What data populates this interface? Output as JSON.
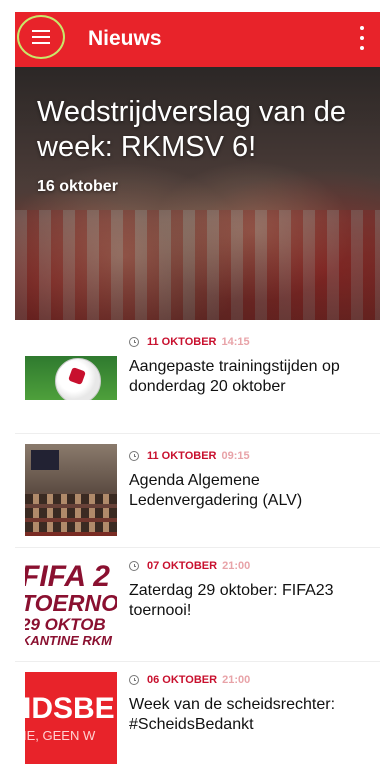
{
  "appbar": {
    "title": "Nieuws",
    "menu_icon": "hamburger-menu-icon",
    "more_icon": "more-vertical-icon",
    "color": "#e8232a"
  },
  "featured": {
    "title": "Wedstrijdverslag van de week: RKMSV 6!",
    "date": "16 oktober"
  },
  "articles": [
    {
      "date": "11 OKTOBER",
      "time": "14:15",
      "title": "Aangepaste trainingstijden op donderdag 20 oktober"
    },
    {
      "date": "11 OKTOBER",
      "time": "09:15",
      "title": "Agenda Algemene Ledenvergadering (ALV)"
    },
    {
      "date": "07 OKTOBER",
      "time": "21:00",
      "title": "Zaterdag 29 oktober: FIFA23 toernooi!"
    },
    {
      "date": "06 OKTOBER",
      "time": "21:00",
      "title": "Week van de scheidsrechter: #ScheidsBedankt"
    }
  ],
  "thumbs": {
    "fifa_lines": [
      "FIFA 2",
      "TOERNO",
      "29 OKTOB",
      "KANTINE RKM"
    ],
    "ref_big": "IDSBE",
    "ref_small": "IE, GEEN W"
  },
  "colors": {
    "accent": "#e8232a",
    "date_red": "#c8102e",
    "time_pink": "#e8a3a8"
  }
}
